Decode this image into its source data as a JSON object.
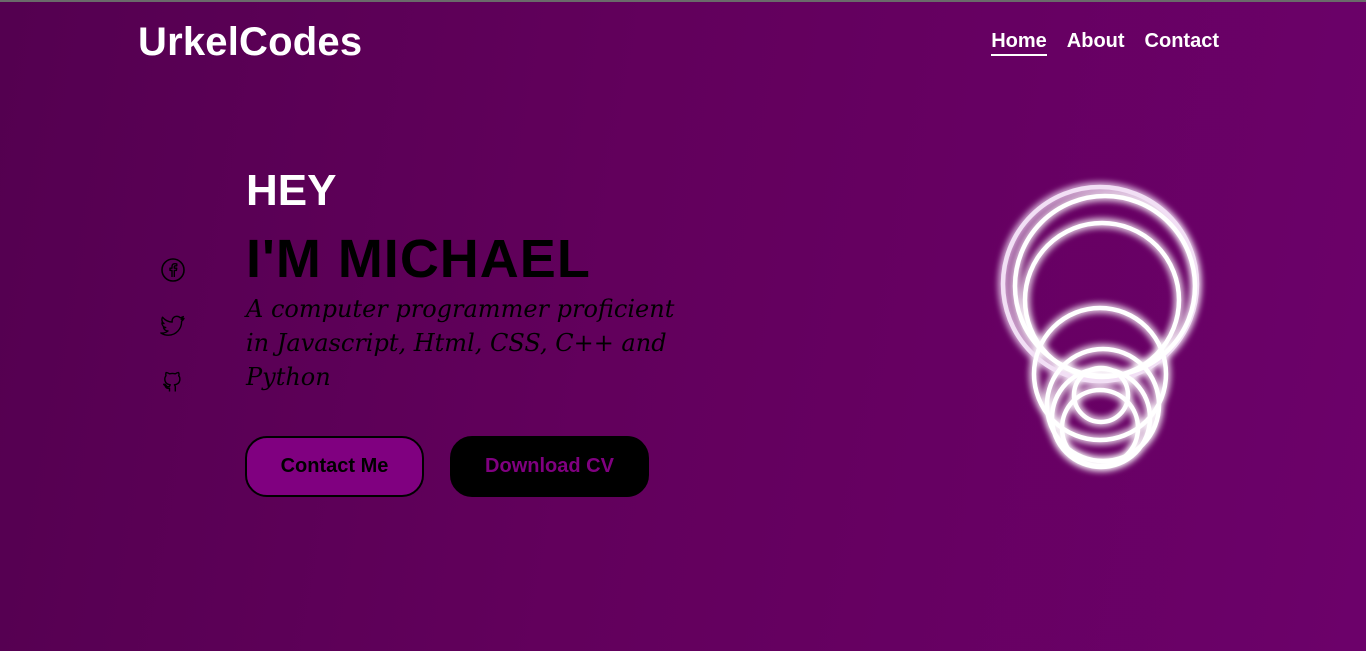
{
  "brand": {
    "logo": "UrkelCodes"
  },
  "nav": {
    "items": [
      {
        "label": "Home",
        "active": true
      },
      {
        "label": "About",
        "active": false
      },
      {
        "label": "Contact",
        "active": false
      }
    ]
  },
  "socials": [
    {
      "icon": "facebook-icon"
    },
    {
      "icon": "twitter-icon"
    },
    {
      "icon": "github-icon"
    }
  ],
  "hero": {
    "greeting": "HEY",
    "name": "I'M MICHAEL",
    "tagline": "A computer programmer proficient in Javascript, Html, CSS, C++ and Python"
  },
  "buttons": {
    "contact_label": "Contact Me",
    "cv_label": "Download CV"
  },
  "colors": {
    "background": "#62005c",
    "accent": "#800080",
    "text_light": "#ffffff",
    "text_dark": "#000000"
  }
}
